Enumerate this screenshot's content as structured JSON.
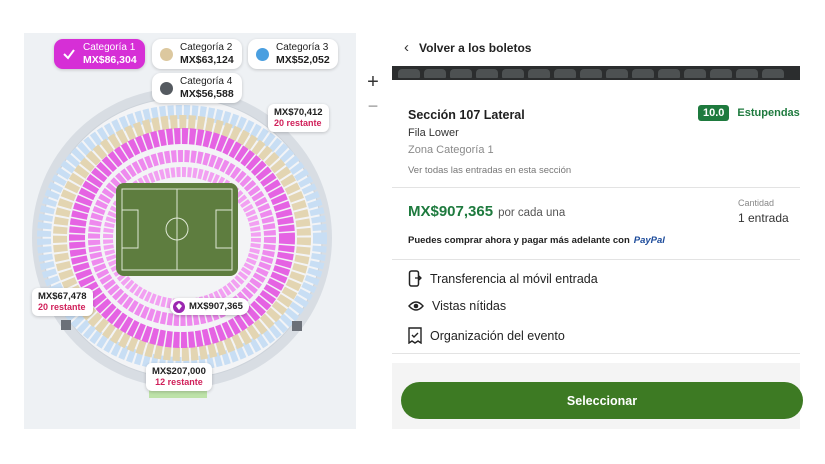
{
  "categories": [
    {
      "name": "Categoría 1",
      "price": "MX$86,304",
      "color": "#d62fd6",
      "active": true
    },
    {
      "name": "Categoría 2",
      "price": "MX$63,124",
      "color": "#dcc89f",
      "active": false
    },
    {
      "name": "Categoría 3",
      "price": "MX$52,052",
      "color": "#4a9fe0",
      "active": false
    },
    {
      "name": "Categoría 4",
      "price": "MX$56,588",
      "color": "#555a60",
      "active": false
    }
  ],
  "map_tags": {
    "top_right": {
      "price": "MX$70,412",
      "remaining": "20 restante"
    },
    "left": {
      "price": "MX$67,478",
      "remaining": "20 restante"
    },
    "bottom": {
      "price": "MX$207,000",
      "remaining": "12 restante"
    },
    "selected": {
      "price": "MX$907,365"
    }
  },
  "zoom": {
    "in": "+",
    "out": "−"
  },
  "details": {
    "back_label": "Volver a los boletos",
    "section_title": "Sección 107 Lateral",
    "row": "Fila Lower",
    "zone": "Zona Categoría 1",
    "all_tickets_link": "Ver todas las entradas en esta sección",
    "score": "10.0",
    "score_label": "Estupendas",
    "price": "MX$907,365",
    "price_unit": "por cada una",
    "qty_label": "Cantidad",
    "qty_value": "1 entrada",
    "paypal_text": "Puedes comprar ahora y pagar más adelante con",
    "paypal_brand": "PayPal",
    "features": [
      "Transferencia al móvil entrada",
      "Vistas nítidas",
      "Organización del evento"
    ],
    "select_button": "Seleccionar"
  },
  "colors": {
    "accent_green": "#1e7a3e",
    "button_green": "#3d7a23",
    "cat1": "#d62fd6",
    "remaining_red": "#d0205a"
  }
}
